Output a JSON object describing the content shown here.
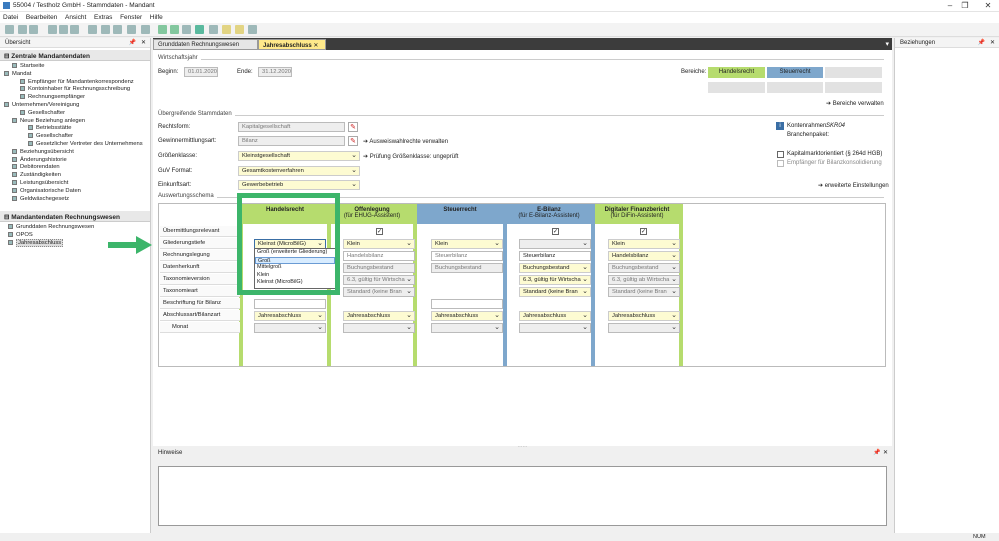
{
  "window": {
    "title": "55004 / Testholz GmbH - Stammdaten - Mandant"
  },
  "menu": [
    "Datei",
    "Bearbeiten",
    "Ansicht",
    "Extras",
    "Fenster",
    "Hilfe"
  ],
  "left_panel": {
    "title": "Übersicht",
    "section1": "Zentrale Mandantendaten",
    "tree": [
      {
        "label": "Startseite",
        "indent": 1
      },
      {
        "label": "Mandat",
        "indent": 0
      },
      {
        "label": "Empfänger für Mandantenkorrespondenz",
        "indent": 2
      },
      {
        "label": "Kontoinhaber für Rechnungsschreibung",
        "indent": 2
      },
      {
        "label": "Rechnungsempfänger",
        "indent": 2
      },
      {
        "label": "Unternehmen/Vereinigung",
        "indent": 0
      },
      {
        "label": "Gesellschafter",
        "indent": 2
      },
      {
        "label": "Neue Beziehung anlegen",
        "indent": 1
      },
      {
        "label": "Betriebsstätte",
        "indent": 3
      },
      {
        "label": "Gesellschafter",
        "indent": 3
      },
      {
        "label": "Gesetzlicher Vertreter des Unternehmens",
        "indent": 3
      },
      {
        "label": "Beziehungsübersicht",
        "indent": 1
      },
      {
        "label": "Änderungshistorie",
        "indent": 1
      },
      {
        "label": "Debitorendaten",
        "indent": 1
      },
      {
        "label": "Zuständigkeiten",
        "indent": 1
      },
      {
        "label": "Leistungsübersicht",
        "indent": 1
      },
      {
        "label": "Organisatorische Daten",
        "indent": 1
      },
      {
        "label": "Geldwäschegesetz",
        "indent": 1
      }
    ],
    "section2": "Mandantendaten Rechnungswesen",
    "tree2": [
      {
        "label": "Grunddaten Rechnungswesen",
        "selected": false
      },
      {
        "label": "OPOS",
        "selected": false
      },
      {
        "label": "Jahresabschluss",
        "selected": true
      }
    ]
  },
  "tabs": [
    {
      "label": "Grunddaten Rechnungswesen",
      "active": false
    },
    {
      "label": "Jahresabschluss",
      "active": true
    }
  ],
  "wirtschaftsjahr": {
    "group": "Wirtschaftsjahr",
    "beginn_label": "Beginn:",
    "beginn": "01.01.2020",
    "ende_label": "Ende:",
    "ende": "31.12.2020"
  },
  "bereiche": {
    "label": "Bereiche:",
    "handelsrecht": "Handelsrecht",
    "steuerrecht": "Steuerrecht",
    "verwalten": "Bereiche verwalten"
  },
  "stammdaten": {
    "group": "Übergreifende Stammdaten",
    "rechtsform_label": "Rechtsform:",
    "rechtsform": "Kapitalgesellschaft",
    "gewinn_label": "Gewinnermittlungsart:",
    "gewinn": "Bilanz",
    "ausweis_link": "Ausweiswahlrechte verwalten",
    "groesse_label": "Größenklasse:",
    "groesse": "Kleinstgesellschaft",
    "pruefung_link": "Prüfung Größenklasse: ungeprüft",
    "guv_label": "GuV Format:",
    "guv": "Gesamtkostenverfahren",
    "einkunft_label": "Einkunftsart:",
    "einkunft": "Gewerbebetrieb",
    "kontenrahmen_label": "Kontenrahmen:",
    "kontenrahmen": "SKR04",
    "branchenpaket_label": "Branchenpaket:",
    "kapital": "Kapitalmarktorientiert (§ 264d HGB)",
    "empfaenger": "Empfänger für Bilanzkonsolidierung",
    "erweitert": "erweiterte Einstellungen"
  },
  "schema": {
    "group": "Auswertungsschema",
    "columns": [
      {
        "title": "Handelsrecht",
        "sub": ""
      },
      {
        "title": "Offenlegung",
        "sub": "(für EHUG-Assistent)"
      },
      {
        "title": "Steuerrecht",
        "sub": ""
      },
      {
        "title": "E-Bilanz",
        "sub": "(für E-Bilanz-Assistent)"
      },
      {
        "title": "Digitaler Finanzbericht",
        "sub": "(für DiFin-Assistent)"
      }
    ],
    "rows": [
      "Übermittlungsrelevant",
      "Gliederungstiefe",
      "Rechnungslegung",
      "Datenherkunft",
      "Taxonomieversion",
      "Taxonomieart",
      "Beschriftung für Bilanz",
      "Abschlussart/Bilanzart",
      "Monat"
    ],
    "cells": {
      "glied": [
        "Kleinst (MicroBilG)",
        "Klein",
        "Klein",
        "",
        "Klein"
      ],
      "rechn": [
        "",
        "Handelsbilanz",
        "Steuerbilanz",
        "Steuerbilanz",
        "Handelsbilanz"
      ],
      "daten": [
        "",
        "Buchungsbestand",
        "Buchungsbestand",
        "Buchungsbestand",
        "Buchungsbestand"
      ],
      "taxv": [
        "",
        "6.3, gültig für Wirtscha",
        "",
        "6.3, gültig für Wirtscha",
        "6.3, gültig ab Wirtscha"
      ],
      "taxa": [
        "",
        "Standard (keine Bran",
        "",
        "Standard (keine Bran",
        "Standard (keine Bran"
      ],
      "abschl": [
        "Jahresabschluss",
        "Jahresabschluss",
        "Jahresabschluss",
        "Jahresabschluss",
        "Jahresabschluss"
      ]
    },
    "dropdown_options": [
      "Groß (erweiterte Gliederung)",
      "Groß",
      "Mittelgroß",
      "Klein",
      "Kleinst (MicroBilG)"
    ]
  },
  "hinweise": {
    "title": "Hinweise"
  },
  "right_panel": {
    "title": "Beziehungen"
  },
  "status": {
    "num": "NUM"
  },
  "colors": {
    "green": "#b6dc6e",
    "blue": "#7ea7cc",
    "highlight": "#3cb56a"
  }
}
